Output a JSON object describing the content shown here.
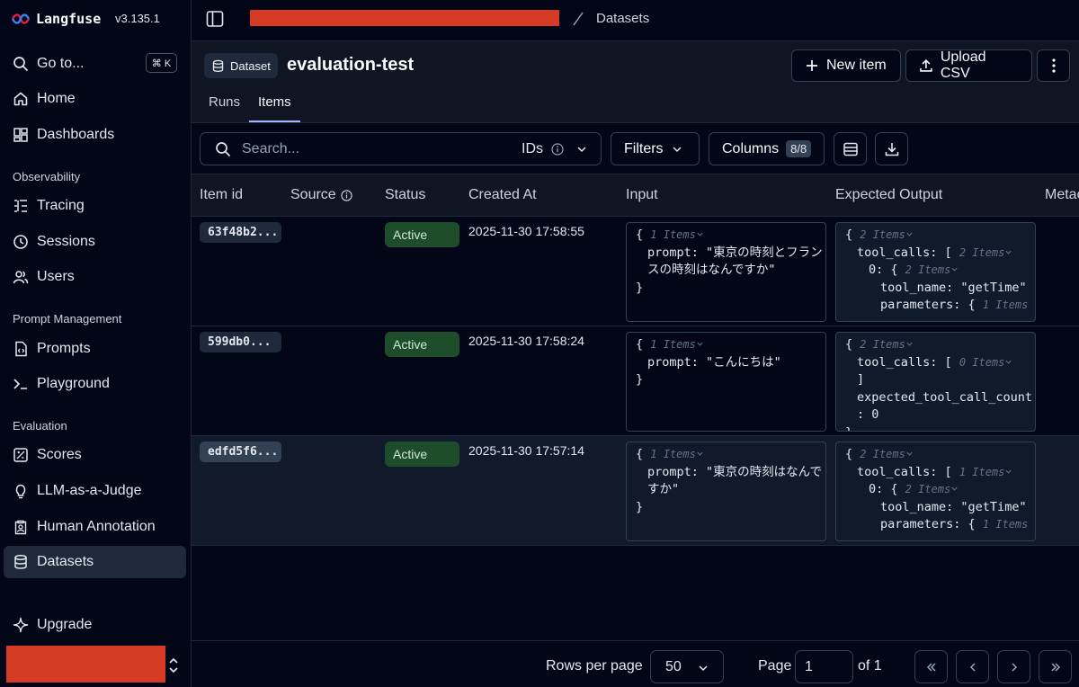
{
  "app": {
    "name": "Langfuse",
    "version": "v3.135.1"
  },
  "sidebar": {
    "goto": {
      "label": "Go to...",
      "shortcut": "⌘ K"
    },
    "home": "Home",
    "dashboards": "Dashboards",
    "observability_section": "Observability",
    "tracing": "Tracing",
    "sessions": "Sessions",
    "users": "Users",
    "prompt_section": "Prompt Management",
    "prompts": "Prompts",
    "playground": "Playground",
    "evaluation_section": "Evaluation",
    "scores": "Scores",
    "llm_judge": "LLM-as-a-Judge",
    "human_annotation": "Human Annotation",
    "datasets": "Datasets",
    "upgrade": "Upgrade"
  },
  "header": {
    "breadcrumb_current": "Datasets"
  },
  "dataset": {
    "badge": "Dataset",
    "name": "evaluation-test",
    "new_item": "New item",
    "upload_csv": "Upload CSV",
    "tabs": [
      "Runs",
      "Items"
    ],
    "active_tab": "Items"
  },
  "toolbar": {
    "search_placeholder": "Search...",
    "ids_label": "IDs",
    "filters_label": "Filters",
    "columns_label": "Columns",
    "columns_count": "8/8"
  },
  "table": {
    "headers": [
      "Item id",
      "Source",
      "Status",
      "Created At",
      "Input",
      "Expected Output",
      "Metac"
    ],
    "rows": [
      {
        "id": "63f48b2...",
        "status": "Active",
        "created": "2025-11-30 17:58:55",
        "input": {
          "open": "{",
          "meta": "1 Items",
          "key": "prompt:",
          "val1": "\"東京の時刻とフラン",
          "val2": "スの時刻はなんですか\"",
          "close": "}"
        },
        "output": {
          "open": "{",
          "meta": "2 Items",
          "l2key": "tool_calls: [",
          "l2meta": "2 Items",
          "l3key": "0: {",
          "l3meta": "2 Items",
          "l4key": "tool_name:",
          "l4val": "\"getTime\"",
          "l5key": "parameters: {",
          "l5meta": "1 Items"
        }
      },
      {
        "id": "599db0...",
        "status": "Active",
        "created": "2025-11-30 17:58:24",
        "input": {
          "open": "{",
          "meta": "1 Items",
          "key": "prompt:",
          "val1": "\"こんにちは\"",
          "close": "}"
        },
        "output": {
          "open": "{",
          "meta": "2 Items",
          "l2key": "tool_calls: [",
          "l2meta": "0 Items",
          "l3": "]",
          "l4": "expected_tool_call_count",
          "l5": ": 0",
          "l6": "}"
        }
      },
      {
        "id": "edfd5f6...",
        "status": "Active",
        "created": "2025-11-30 17:57:14",
        "input": {
          "open": "{",
          "meta": "1 Items",
          "key": "prompt:",
          "val1": "\"東京の時刻はなんで",
          "val2": "すか\"",
          "close": "}"
        },
        "output": {
          "open": "{",
          "meta": "2 Items",
          "l2key": "tool_calls: [",
          "l2meta": "1 Items",
          "l3key": "0: {",
          "l3meta": "2 Items",
          "l4key": "tool_name:",
          "l4val": "\"getTime\"",
          "l5key": "parameters: {",
          "l5meta": "1 Items"
        }
      }
    ]
  },
  "pagination": {
    "rows_label": "Rows per page",
    "rows_value": "50",
    "page_label": "Page",
    "page_value": "1",
    "of_label": "of 1"
  },
  "colors": {
    "accent": "#a5b4fc",
    "active_badge": "#1e4d2b",
    "redaction": "#d43a24"
  }
}
